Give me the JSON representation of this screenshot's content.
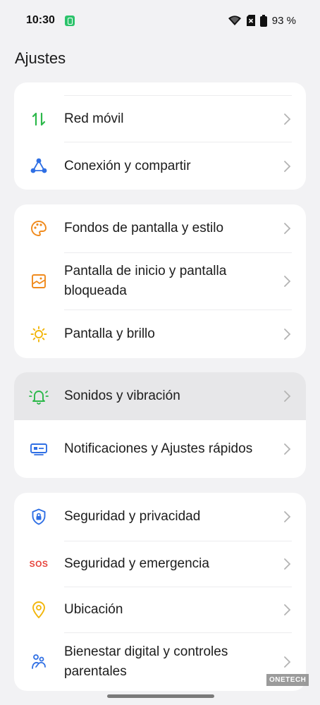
{
  "status_bar": {
    "time": "10:30",
    "battery_percent": "93 %"
  },
  "page_title": "Ajustes",
  "groups": [
    {
      "items": [
        {
          "label": "Red móvil",
          "icon": "mobile-data-arrows-icon"
        },
        {
          "label": "Conexión y compartir",
          "icon": "connection-share-icon"
        }
      ]
    },
    {
      "items": [
        {
          "label": "Fondos de pantalla y estilo",
          "icon": "palette-icon"
        },
        {
          "label": "Pantalla de inicio y pantalla bloqueada",
          "icon": "home-lock-screen-icon"
        },
        {
          "label": "Pantalla y brillo",
          "icon": "sun-icon"
        }
      ]
    },
    {
      "items": [
        {
          "label": "Sonidos y vibración",
          "icon": "bell-vibration-icon",
          "highlighted": true
        },
        {
          "label": "Notificaciones y Ajustes rápidos",
          "icon": "notification-panel-icon"
        }
      ]
    },
    {
      "items": [
        {
          "label": "Seguridad y privacidad",
          "icon": "shield-lock-icon"
        },
        {
          "label": "Seguridad y emergencia",
          "icon": "sos-icon",
          "icon_text": "SOS"
        },
        {
          "label": "Ubicación",
          "icon": "location-pin-icon"
        },
        {
          "label": "Bienestar digital y controles parentales",
          "icon": "digital-wellbeing-icon"
        }
      ]
    }
  ],
  "watermark": "ONETECH",
  "colors": {
    "background": "#f2f2f4",
    "card": "#ffffff",
    "highlight": "#e7e7e9",
    "green": "#2cb84a",
    "blue": "#2f6fe4",
    "orange": "#f08a1c",
    "yellow": "#f2b60c",
    "red": "#e6423a"
  }
}
